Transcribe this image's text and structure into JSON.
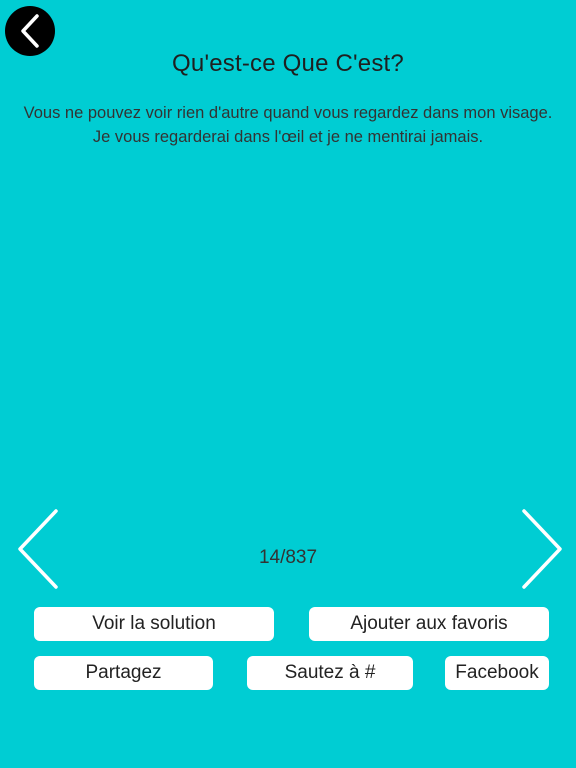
{
  "header": {
    "back_icon": "chevron-left-icon",
    "title": "Qu'est-ce Que C'est?"
  },
  "riddle": {
    "text": "Vous ne pouvez voir rien d'autre quand vous regardez dans mon visage. Je vous regarderai dans l'œil et je ne mentirai jamais."
  },
  "navigation": {
    "prev_icon": "chevron-left-icon",
    "next_icon": "chevron-right-icon",
    "counter": "14/837"
  },
  "actions": {
    "solution_label": "Voir la solution",
    "favorites_label": "Ajouter aux favoris",
    "share_label": "Partagez",
    "jump_label": "Sautez à #",
    "facebook_label": "Facebook"
  },
  "colors": {
    "background": "#00CDD3",
    "button": "#FFFFFF",
    "back_button": "#000000"
  }
}
